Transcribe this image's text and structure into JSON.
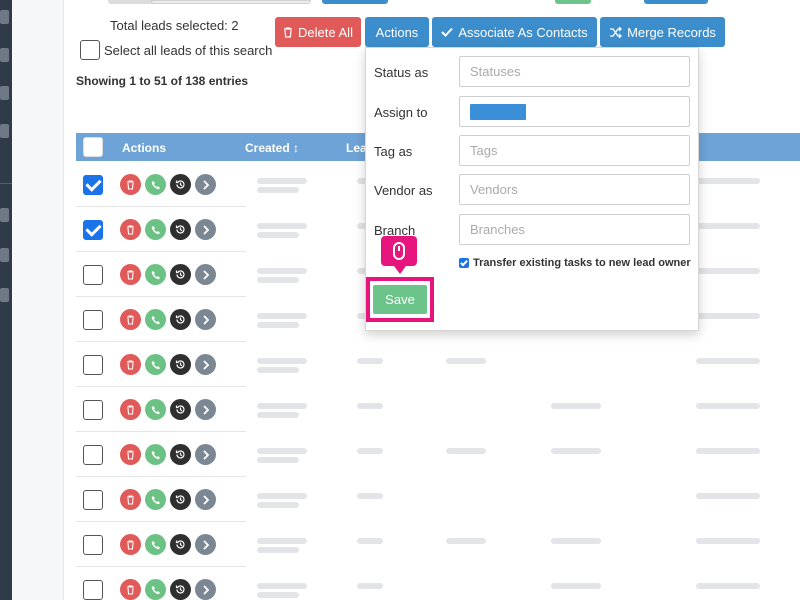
{
  "selection": {
    "total_text": "Total leads selected: 2",
    "select_all_label": "Select all leads of this search"
  },
  "info": {
    "showing": "Showing 1 to 51 of 138 entries"
  },
  "toolbar": {
    "delete_all": "Delete All",
    "actions": "Actions",
    "associate": "Associate As Contacts",
    "merge": "Merge Records"
  },
  "table": {
    "headers": {
      "actions": "Actions",
      "created": "Created ↕",
      "lead": "Lea"
    },
    "rows": [
      {
        "checked": true
      },
      {
        "checked": true
      },
      {
        "checked": false
      },
      {
        "checked": false
      },
      {
        "checked": false
      },
      {
        "checked": false
      },
      {
        "checked": false
      },
      {
        "checked": false
      },
      {
        "checked": false
      },
      {
        "checked": false
      }
    ]
  },
  "actions_panel": {
    "status_label": "Status as",
    "status_placeholder": "Statuses",
    "assign_label": "Assign to",
    "tag_label": "Tag as",
    "tag_placeholder": "Tags",
    "vendor_label": "Vendor as",
    "vendor_placeholder": "Vendors",
    "branch_label": "Branch",
    "branch_placeholder": "Branches",
    "transfer_label": "Transfer existing tasks to new lead owner",
    "save": "Save"
  },
  "colors": {
    "primary": "#3c8dcb",
    "danger": "#e05a5a",
    "success": "#6cc48a",
    "highlight": "#e5157d"
  },
  "icons": {
    "delete": "trash-icon",
    "actions": [
      "trash-icon",
      "phone-icon",
      "history-icon",
      "chevron-right-icon"
    ],
    "associate": "check-icon",
    "merge": "shuffle-icon",
    "cursor": "mouse-icon"
  }
}
